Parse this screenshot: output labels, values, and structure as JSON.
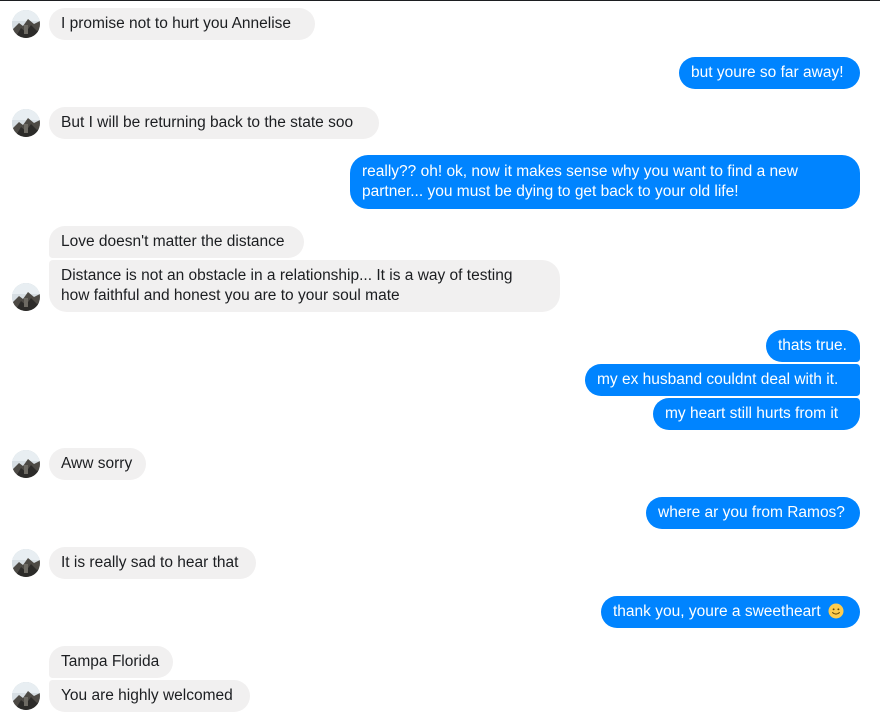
{
  "messages": [
    {
      "id": "m1",
      "side": "in",
      "text": "I promise not to hurt you Annelise"
    },
    {
      "id": "m2",
      "side": "out",
      "text": "but youre so far away!"
    },
    {
      "id": "m3",
      "side": "in",
      "text": "But I will be returning back to the state soo"
    },
    {
      "id": "m4",
      "side": "out",
      "line1": "really?? oh! ok, now it makes sense why you want to find a new",
      "line2": "partner... you must be dying to get back to your old life!"
    },
    {
      "id": "m5",
      "side": "in",
      "text": "Love doesn't matter the distance"
    },
    {
      "id": "m6",
      "side": "in",
      "line1": "Distance is not an obstacle in a relationship... It is a way of testing",
      "line2": "how faithful and honest you are to your soul mate"
    },
    {
      "id": "m7",
      "side": "out",
      "text": "thats true."
    },
    {
      "id": "m8",
      "side": "out",
      "text": "my ex husband couldnt deal with it."
    },
    {
      "id": "m9",
      "side": "out",
      "text": "my heart still hurts from it"
    },
    {
      "id": "m10",
      "side": "in",
      "text": "Aww sorry"
    },
    {
      "id": "m11",
      "side": "out",
      "text": "where ar you from Ramos?"
    },
    {
      "id": "m12",
      "side": "in",
      "text": "It is really sad to hear that"
    },
    {
      "id": "m13",
      "side": "out",
      "text": "thank you, youre a sweetheart",
      "emoji": "slightly-smiling-face-icon"
    },
    {
      "id": "m14",
      "side": "in",
      "text": "Tampa Florida"
    },
    {
      "id": "m15",
      "side": "in",
      "text": "You are highly welcomed"
    }
  ],
  "colors": {
    "incoming_bg": "#f1f0f0",
    "outgoing_bg": "#0084ff",
    "incoming_text": "#1c1e21",
    "outgoing_text": "#ffffff"
  },
  "icons": {
    "avatar": "contact-avatar-photo",
    "emoji": "slightly-smiling-face-icon"
  }
}
